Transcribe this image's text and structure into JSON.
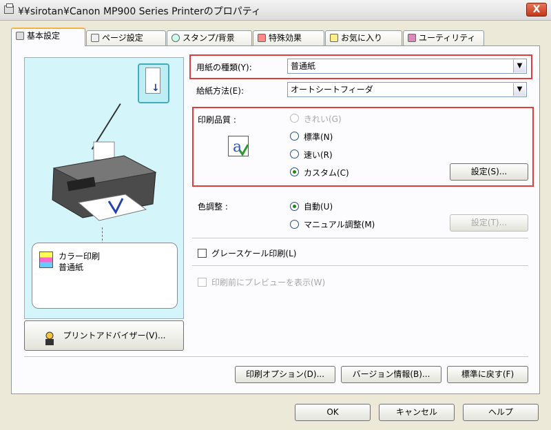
{
  "window": {
    "title": "¥¥sirotan¥Canon MP900 Series Printerのプロパティ",
    "close_label": "X"
  },
  "tabs": [
    {
      "label": "基本設定",
      "icon": "printer-settings-icon"
    },
    {
      "label": "ページ設定",
      "icon": "page-setup-icon"
    },
    {
      "label": "スタンプ/背景",
      "icon": "stamp-icon"
    },
    {
      "label": "特殊効果",
      "icon": "effects-brush-icon"
    },
    {
      "label": "お気に入り",
      "icon": "favorites-icon"
    },
    {
      "label": "ユーティリティ",
      "icon": "utility-icon"
    }
  ],
  "preview": {
    "info_line1": "カラー印刷",
    "info_line2": "普通紙",
    "advisor_button": "プリントアドバイザー(V)..."
  },
  "media": {
    "label": "用紙の種類(Y):",
    "value": "普通紙"
  },
  "feed": {
    "label": "給紙方法(E):",
    "value": "オートシートフィーダ"
  },
  "quality": {
    "label": "印刷品質 :",
    "options": [
      {
        "label": "きれい(G)",
        "selected": false,
        "enabled": false
      },
      {
        "label": "標準(N)",
        "selected": false,
        "enabled": true
      },
      {
        "label": "速い(R)",
        "selected": false,
        "enabled": true
      },
      {
        "label": "カスタム(C)",
        "selected": true,
        "enabled": true
      }
    ],
    "settings_button": "設定(S)..."
  },
  "color": {
    "label": "色調整 :",
    "options": [
      {
        "label": "自動(U)",
        "selected": true
      },
      {
        "label": "マニュアル調整(M)",
        "selected": false
      }
    ],
    "settings_button": "設定(T)..."
  },
  "grayscale": {
    "label": "グレースケール印刷(L)",
    "checked": false
  },
  "preview_before_print": {
    "label": "印刷前にプレビューを表示(W)",
    "checked": false,
    "enabled": false
  },
  "bottom_buttons": {
    "print_options": "印刷オプション(D)...",
    "version": "バージョン情報(B)...",
    "defaults": "標準に戻す(F)"
  },
  "dialog_buttons": {
    "ok": "OK",
    "cancel": "キャンセル",
    "help": "ヘルプ"
  },
  "colors": {
    "highlight": "#e23b3b",
    "preview_bg": "#d4f6fa"
  }
}
